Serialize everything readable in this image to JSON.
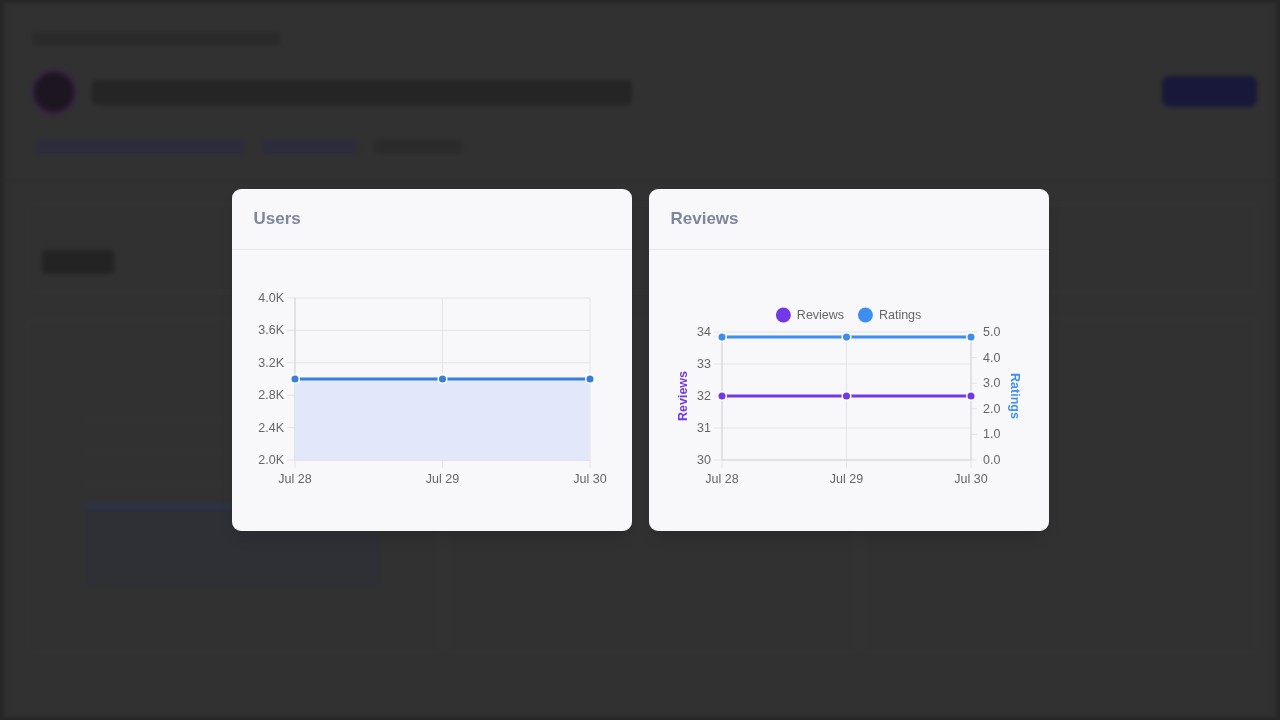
{
  "cards": [
    {
      "title": "Users",
      "chart_data": {
        "type": "area",
        "grid": true,
        "categories": [
          "Jul 28",
          "Jul 29",
          "Jul 30"
        ],
        "series": [
          {
            "color": "#3b7ddd",
            "marker": true,
            "values": [
              3000,
              3000,
              3000
            ]
          }
        ],
        "ylim": [
          2000,
          4000
        ],
        "yticks": [
          {
            "value": 2000,
            "label": "2.0K"
          },
          {
            "value": 2400,
            "label": "2.4K"
          },
          {
            "value": 2800,
            "label": "2.8K"
          },
          {
            "value": 3200,
            "label": "3.2K"
          },
          {
            "value": 3600,
            "label": "3.6K"
          },
          {
            "value": 4000,
            "label": "4.0K"
          }
        ]
      }
    },
    {
      "title": "Reviews",
      "chart_data": {
        "type": "line",
        "grid": true,
        "legend": "top",
        "categories": [
          "Jul 28",
          "Jul 29",
          "Jul 30"
        ],
        "series": [
          {
            "name": "Reviews",
            "color": "#7239ea",
            "axis": "y",
            "marker": true,
            "values": [
              32,
              32,
              32
            ]
          },
          {
            "name": "Ratings",
            "color": "#3d8ef0",
            "axis": "y2",
            "marker": true,
            "values": [
              4.8,
              4.8,
              4.8
            ]
          }
        ],
        "ylabel": "Reviews",
        "ylim": [
          30,
          34
        ],
        "yticks": [
          30,
          31,
          32,
          33,
          34
        ],
        "y2label": "Ratings",
        "y2lim": [
          0,
          5
        ],
        "y2ticks": [
          {
            "value": 0,
            "label": "0.0"
          },
          {
            "value": 1,
            "label": "1.0"
          },
          {
            "value": 2,
            "label": "2.0"
          },
          {
            "value": 3,
            "label": "3.0"
          },
          {
            "value": 4,
            "label": "4.0"
          },
          {
            "value": 5,
            "label": "5.0"
          }
        ]
      }
    }
  ]
}
